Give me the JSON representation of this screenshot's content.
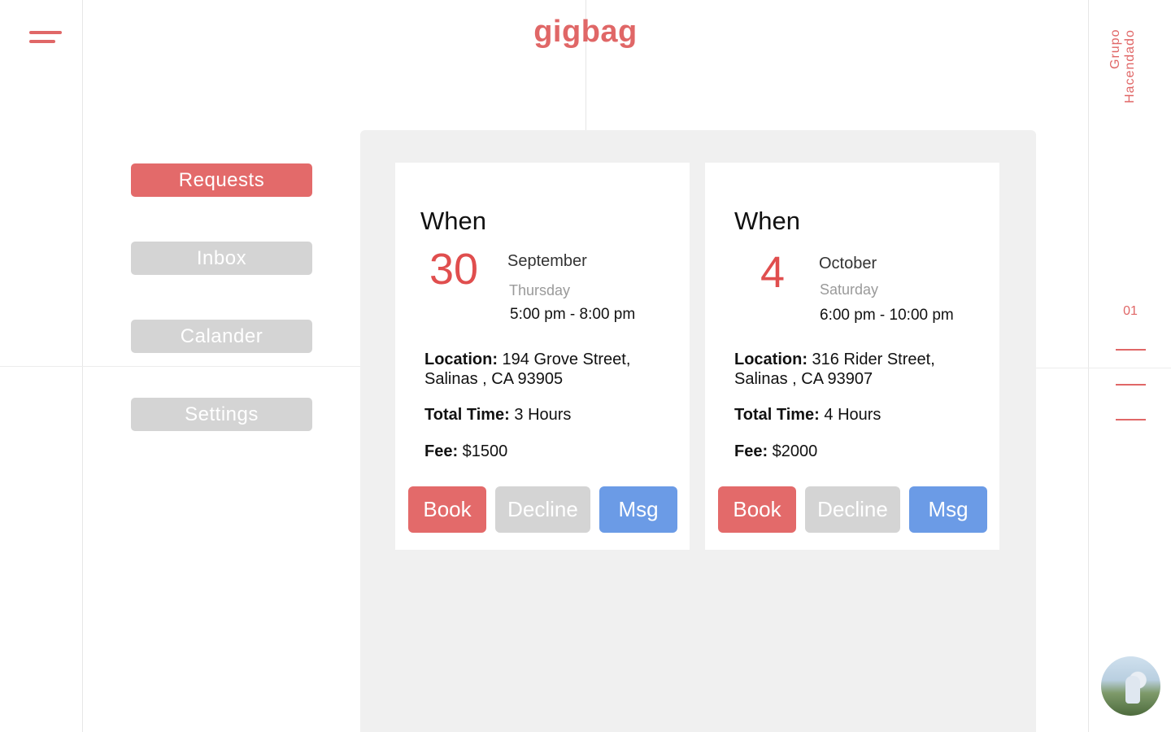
{
  "brand": "gigbag",
  "org_label": "Grupo Hacendado",
  "nav": [
    {
      "label": "Requests",
      "active": true
    },
    {
      "label": "Inbox",
      "active": false
    },
    {
      "label": "Calander",
      "active": false
    },
    {
      "label": "Settings",
      "active": false
    }
  ],
  "cards": [
    {
      "when_label": "When",
      "day": "30",
      "month": "September",
      "weekday": "Thursday",
      "time": "5:00 pm - 8:00 pm",
      "location_label": "Location:",
      "location_line1": " 194 Grove Street,",
      "location_line2": "Salinas , CA 93905",
      "total_time_label": "Total Time:",
      "total_time_value": " 3 Hours",
      "fee_label": "Fee:",
      "fee_value": " $1500",
      "book_label": "Book",
      "decline_label": "Decline",
      "msg_label": "Msg"
    },
    {
      "when_label": "When",
      "day": "4",
      "month": "October",
      "weekday": "Saturday",
      "time": "6:00 pm - 10:00 pm",
      "location_label": "Location:",
      "location_line1": " 316 Rider Street,",
      "location_line2": "Salinas , CA 93907",
      "total_time_label": "Total Time:",
      "total_time_value": " 4 Hours",
      "fee_label": "Fee:",
      "fee_value": " $2000",
      "book_label": "Book",
      "decline_label": "Decline",
      "msg_label": "Msg"
    }
  ],
  "pager": {
    "current": "01"
  },
  "colors": {
    "accent": "#e36a6a",
    "day_number": "#e04e4e",
    "inactive": "#d4d4d4",
    "msg": "#6b9be6",
    "panel_bg": "#f0f0f0"
  },
  "icons": {
    "menu": "hamburger-icon",
    "avatar": "user-avatar"
  }
}
